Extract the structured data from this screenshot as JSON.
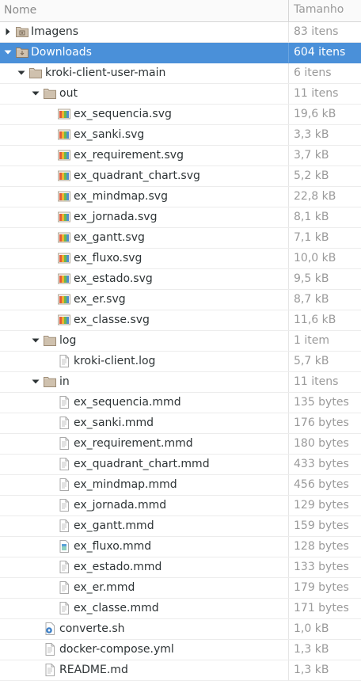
{
  "header": {
    "name_label": "Nome",
    "size_label": "Tamanho"
  },
  "rows": [
    {
      "label": "Imagens",
      "size": "83 itens",
      "depth": 0,
      "icon": "folder-pictures-icon",
      "expander": "collapsed",
      "selected": false
    },
    {
      "label": "Downloads",
      "size": "604 itens",
      "depth": 0,
      "icon": "folder-download-icon",
      "expander": "expanded",
      "selected": true
    },
    {
      "label": "kroki-client-user-main",
      "size": "6 itens",
      "depth": 1,
      "icon": "folder-icon",
      "expander": "expanded",
      "selected": false
    },
    {
      "label": "out",
      "size": "11 itens",
      "depth": 2,
      "icon": "folder-icon",
      "expander": "expanded",
      "selected": false
    },
    {
      "label": "ex_sequencia.svg",
      "size": "19,6 kB",
      "depth": 3,
      "icon": "svg-image-icon",
      "expander": "none",
      "selected": false
    },
    {
      "label": "ex_sanki.svg",
      "size": "3,3 kB",
      "depth": 3,
      "icon": "svg-image-icon",
      "expander": "none",
      "selected": false
    },
    {
      "label": "ex_requirement.svg",
      "size": "3,7 kB",
      "depth": 3,
      "icon": "svg-image-icon",
      "expander": "none",
      "selected": false
    },
    {
      "label": "ex_quadrant_chart.svg",
      "size": "5,2 kB",
      "depth": 3,
      "icon": "svg-image-icon",
      "expander": "none",
      "selected": false
    },
    {
      "label": "ex_mindmap.svg",
      "size": "22,8 kB",
      "depth": 3,
      "icon": "svg-image-icon",
      "expander": "none",
      "selected": false
    },
    {
      "label": "ex_jornada.svg",
      "size": "8,1 kB",
      "depth": 3,
      "icon": "svg-image-icon",
      "expander": "none",
      "selected": false
    },
    {
      "label": "ex_gantt.svg",
      "size": "7,1 kB",
      "depth": 3,
      "icon": "svg-image-icon",
      "expander": "none",
      "selected": false
    },
    {
      "label": "ex_fluxo.svg",
      "size": "10,0 kB",
      "depth": 3,
      "icon": "svg-image-icon",
      "expander": "none",
      "selected": false
    },
    {
      "label": "ex_estado.svg",
      "size": "9,5 kB",
      "depth": 3,
      "icon": "svg-image-icon",
      "expander": "none",
      "selected": false
    },
    {
      "label": "ex_er.svg",
      "size": "8,7 kB",
      "depth": 3,
      "icon": "svg-image-icon",
      "expander": "none",
      "selected": false
    },
    {
      "label": "ex_classe.svg",
      "size": "11,6 kB",
      "depth": 3,
      "icon": "svg-image-icon",
      "expander": "none",
      "selected": false
    },
    {
      "label": "log",
      "size": "1 item",
      "depth": 2,
      "icon": "folder-icon",
      "expander": "expanded",
      "selected": false
    },
    {
      "label": "kroki-client.log",
      "size": "5,7 kB",
      "depth": 3,
      "icon": "text-file-icon",
      "expander": "none",
      "selected": false
    },
    {
      "label": "in",
      "size": "11 itens",
      "depth": 2,
      "icon": "folder-icon",
      "expander": "expanded",
      "selected": false
    },
    {
      "label": "ex_sequencia.mmd",
      "size": "135 bytes",
      "depth": 3,
      "icon": "text-file-icon",
      "expander": "none",
      "selected": false
    },
    {
      "label": "ex_sanki.mmd",
      "size": "176 bytes",
      "depth": 3,
      "icon": "text-file-icon",
      "expander": "none",
      "selected": false
    },
    {
      "label": "ex_requirement.mmd",
      "size": "180 bytes",
      "depth": 3,
      "icon": "text-file-icon",
      "expander": "none",
      "selected": false
    },
    {
      "label": "ex_quadrant_chart.mmd",
      "size": "433 bytes",
      "depth": 3,
      "icon": "text-file-icon",
      "expander": "none",
      "selected": false
    },
    {
      "label": "ex_mindmap.mmd",
      "size": "456 bytes",
      "depth": 3,
      "icon": "text-file-icon",
      "expander": "none",
      "selected": false
    },
    {
      "label": "ex_jornada.mmd",
      "size": "129 bytes",
      "depth": 3,
      "icon": "text-file-icon",
      "expander": "none",
      "selected": false
    },
    {
      "label": "ex_gantt.mmd",
      "size": "159 bytes",
      "depth": 3,
      "icon": "text-file-icon",
      "expander": "none",
      "selected": false
    },
    {
      "label": "ex_fluxo.mmd",
      "size": "128 bytes",
      "depth": 3,
      "icon": "document-icon",
      "expander": "none",
      "selected": false
    },
    {
      "label": "ex_estado.mmd",
      "size": "133 bytes",
      "depth": 3,
      "icon": "text-file-icon",
      "expander": "none",
      "selected": false
    },
    {
      "label": "ex_er.mmd",
      "size": "179 bytes",
      "depth": 3,
      "icon": "text-file-icon",
      "expander": "none",
      "selected": false
    },
    {
      "label": "ex_classe.mmd",
      "size": "171 bytes",
      "depth": 3,
      "icon": "text-file-icon",
      "expander": "none",
      "selected": false
    },
    {
      "label": "converte.sh",
      "size": "1,0 kB",
      "depth": 2,
      "icon": "script-icon",
      "expander": "none",
      "selected": false
    },
    {
      "label": "docker-compose.yml",
      "size": "1,3 kB",
      "depth": 2,
      "icon": "text-file-icon",
      "expander": "none",
      "selected": false
    },
    {
      "label": "README.md",
      "size": "1,3 kB",
      "depth": 2,
      "icon": "text-file-icon",
      "expander": "none",
      "selected": false
    }
  ],
  "colors": {
    "selection": "#4a90d9",
    "folder": "#c9b9a4",
    "size_text": "#9a9a9a"
  }
}
